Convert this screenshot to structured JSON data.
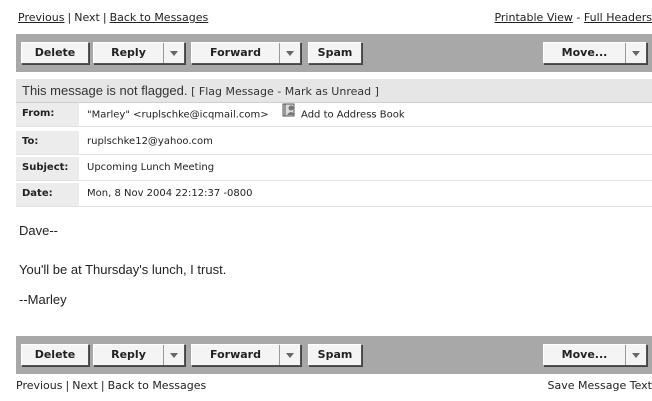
{
  "top_nav": {
    "previous": "Previous",
    "next": "Next",
    "back": "Back to Messages",
    "printable": "Printable View",
    "dash": "-",
    "full_headers": "Full Headers"
  },
  "toolbar": {
    "delete": "Delete",
    "reply": "Reply",
    "forward": "Forward",
    "spam": "Spam",
    "move": "Move..."
  },
  "flag": {
    "status": "This message is not flagged.",
    "bracket_open": "[",
    "flag_message": "Flag Message",
    "dash": "-",
    "mark_unread": "Mark as Unread",
    "bracket_close": "]"
  },
  "headers": {
    "from_label": "From:",
    "from_value": "\"Marley\" <ruplschke@icqmail.com>",
    "add_address_book": "Add to Address Book",
    "to_label": "To:",
    "to_value": "ruplschke12@yahoo.com",
    "subject_label": "Subject:",
    "subject_value": "Upcoming Lunch Meeting",
    "date_label": "Date:",
    "date_value": "Mon, 8 Nov 2004 22:12:37 -0800"
  },
  "body": {
    "line1": "Dave--",
    "line2": "You'll be at Thursday's lunch, I trust.",
    "line3": "--Marley"
  },
  "bottom_nav": {
    "previous": "Previous",
    "next": "Next",
    "back": "Back to Messages",
    "save_text": "Save Message Text"
  },
  "colors": {
    "toolbar": "#a8a8a8",
    "flagbar": "#e6e6e6",
    "header_label_bg": "#ececec"
  },
  "icons": {
    "address_book": "address-book-icon"
  }
}
